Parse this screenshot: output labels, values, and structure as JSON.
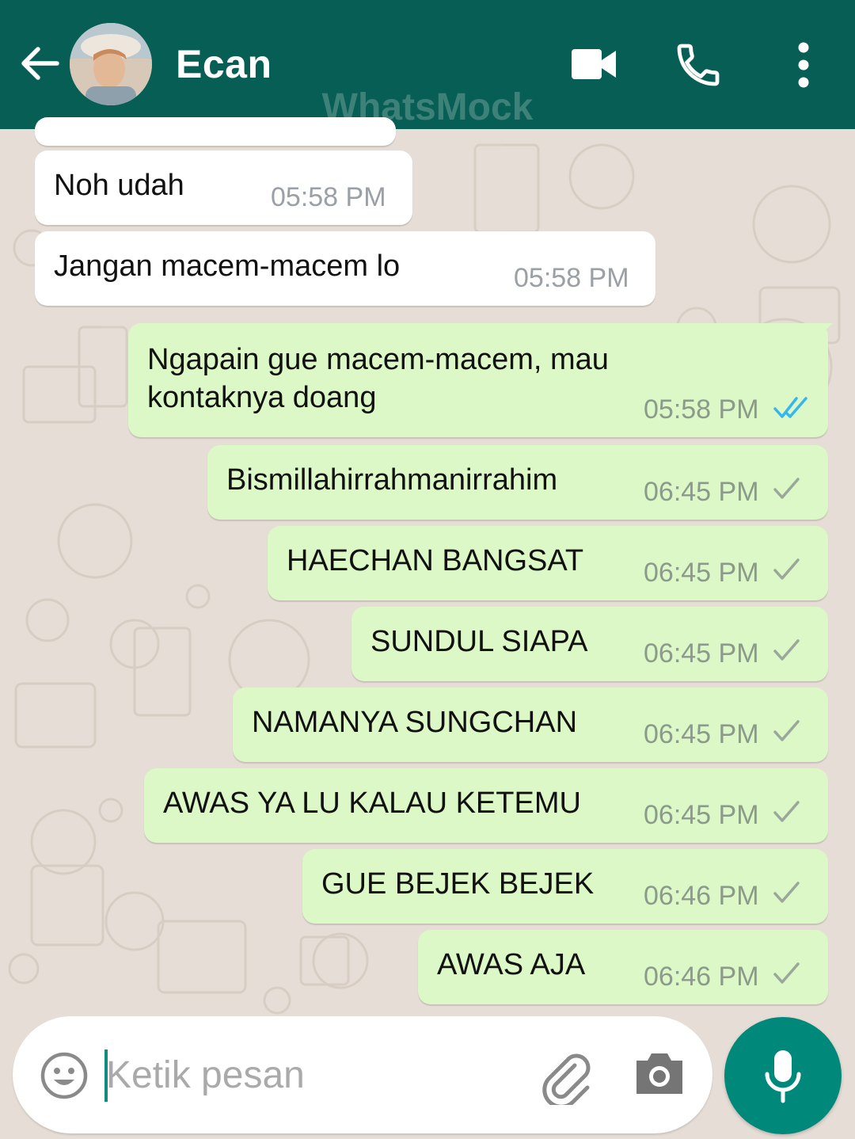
{
  "header": {
    "contact_name": "Ecan",
    "watermark": "WhatsMock",
    "bg_color": "#075e54"
  },
  "icons": {
    "back": "arrow-left-icon",
    "video": "video-camera-icon",
    "call": "phone-icon",
    "menu": "more-vertical-icon",
    "emoji": "smiley-icon",
    "attach": "paperclip-icon",
    "camera": "camera-icon",
    "mic": "microphone-icon"
  },
  "messages": [
    {
      "direction": "in",
      "text": "Noh udah",
      "time": "05:58 PM"
    },
    {
      "direction": "in",
      "text": "Jangan macem-macem lo",
      "time": "05:58 PM"
    },
    {
      "direction": "out",
      "text_line1": "Ngapain gue macem-macem, mau",
      "text_line2": "kontaknya doang",
      "time": "05:58 PM",
      "status": "read"
    },
    {
      "direction": "out",
      "text": "Bismillahirrahmanirrahim",
      "time": "06:45 PM",
      "status": "sent"
    },
    {
      "direction": "out",
      "text": "HAECHAN BANGSAT",
      "time": "06:45 PM",
      "status": "sent"
    },
    {
      "direction": "out",
      "text": "SUNDUL SIAPA",
      "time": "06:45 PM",
      "status": "sent"
    },
    {
      "direction": "out",
      "text": "NAMANYA SUNGCHAN",
      "time": "06:45 PM",
      "status": "sent"
    },
    {
      "direction": "out",
      "text": "AWAS YA LU KALAU KETEMU",
      "time": "06:45 PM",
      "status": "sent"
    },
    {
      "direction": "out",
      "text": "GUE BEJEK BEJEK",
      "time": "06:46 PM",
      "status": "sent"
    },
    {
      "direction": "out",
      "text": "AWAS AJA",
      "time": "06:46 PM",
      "status": "sent"
    }
  ],
  "composer": {
    "placeholder": "Ketik pesan",
    "value": ""
  },
  "colors": {
    "outgoing_bubble": "#dcf8c6",
    "incoming_bubble": "#ffffff",
    "read_tick": "#34b7f1",
    "mic_button": "#00897b"
  }
}
